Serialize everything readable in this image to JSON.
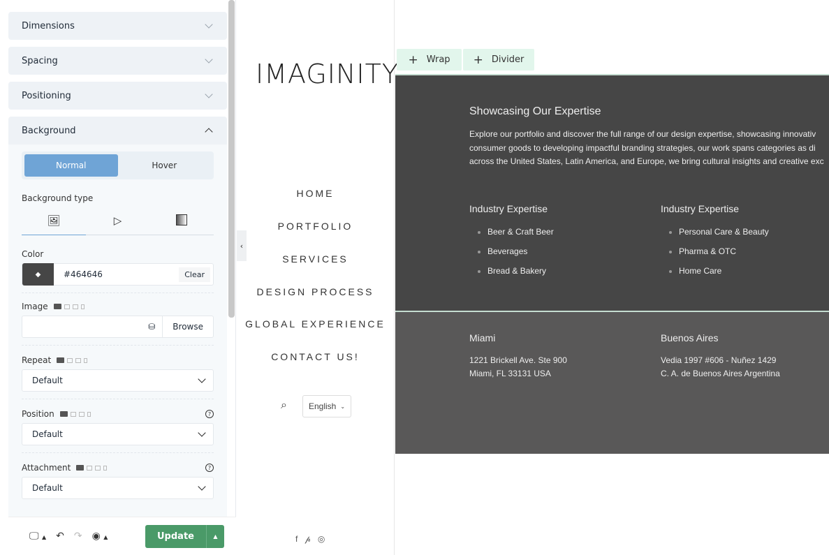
{
  "panel": {
    "sections": [
      {
        "label": "Dimensions"
      },
      {
        "label": "Spacing"
      },
      {
        "label": "Positioning"
      },
      {
        "label": "Background"
      }
    ],
    "state_tabs": [
      "Normal",
      "Hover"
    ],
    "bg_type_label": "Background type",
    "bg_types": [
      "image-icon",
      "video-icon",
      "gradient-icon"
    ],
    "color_label": "Color",
    "color_value": "#464646",
    "clear_label": "Clear",
    "image_label": "Image",
    "browse_label": "Browse",
    "repeat_label": "Repeat",
    "repeat_value": "Default",
    "position_label": "Position",
    "position_value": "Default",
    "attachment_label": "Attachment",
    "attachment_value": "Default",
    "update_label": "Update"
  },
  "site": {
    "logo": "IMAGINITY",
    "menu": [
      "HOME",
      "PORTFOLIO",
      "SERVICES",
      "DESIGN PROCESS",
      "GLOBAL EXPERIENCE",
      "CONTACT US!"
    ],
    "language": "English",
    "add_buttons": [
      "Wrap",
      "Divider"
    ],
    "heading": "Showcasing Our Expertise",
    "paragraph": [
      "Explore our portfolio and discover the full range of our design expertise, showcasing innovativ",
      "consumer goods to developing impactful branding strategies, our work spans categories as di",
      "across the United States, Latin America, and Europe, we bring cultural insights and creative exc"
    ],
    "columns": [
      {
        "title": "Industry Expertise",
        "items": [
          "Beer & Craft Beer",
          "Beverages",
          "Bread & Bakery"
        ]
      },
      {
        "title": "Industry Expertise",
        "items": [
          "Personal Care & Beauty",
          "Pharma & OTC",
          "Home Care"
        ]
      }
    ],
    "offices": [
      {
        "city": "Miami",
        "line1": "1221 Brickell Ave. Ste 900",
        "line2": "Miami, FL 33131 USA"
      },
      {
        "city": "Buenos Aires",
        "line1": "Vedia 1997 #606 - Nuñez 1429",
        "line2": "C. A. de Buenos Aires Argentina"
      }
    ]
  },
  "colors": {
    "accent": "#6fa4d6",
    "update": "#4a9a68",
    "section_dark": "#464646"
  }
}
